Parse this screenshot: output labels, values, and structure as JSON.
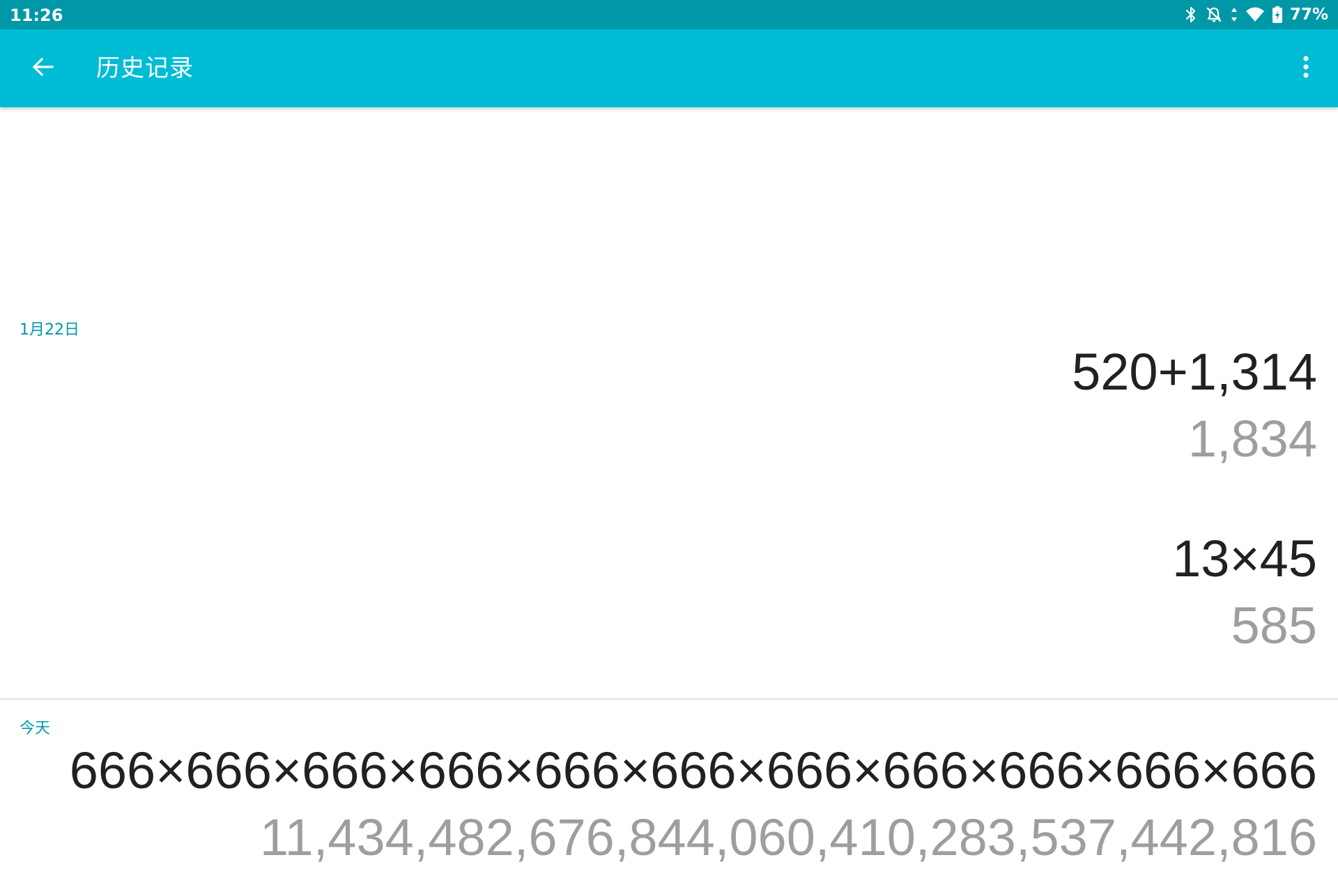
{
  "status_bar": {
    "time": "11:26",
    "battery_percent": "77%",
    "icons": [
      "bluetooth-icon",
      "notifications-off-icon",
      "data-transfer-icon",
      "wifi-icon",
      "battery-charging-icon"
    ]
  },
  "app_bar": {
    "back_icon": "arrow-back-icon",
    "title": "历史记录",
    "overflow_icon": "more-vert-icon"
  },
  "history": {
    "groups": [
      {
        "date": "1月22日",
        "entries": [
          {
            "expression": "520+1,314",
            "result": "1,834"
          },
          {
            "expression": "13×45",
            "result": "585"
          }
        ]
      },
      {
        "date": "今天",
        "entries": [
          {
            "expression": "666×666×666×666×666×666×666×666×666×666×666",
            "result": "11,434,482,676,844,060,410,283,537,442,816"
          }
        ]
      }
    ]
  },
  "colors": {
    "status_bar": "#0097a7",
    "app_bar": "#00bcd4",
    "accent_text": "#0097a7",
    "expression_text": "#212121",
    "result_text": "#9e9e9e",
    "divider": "#e0e0e0"
  }
}
